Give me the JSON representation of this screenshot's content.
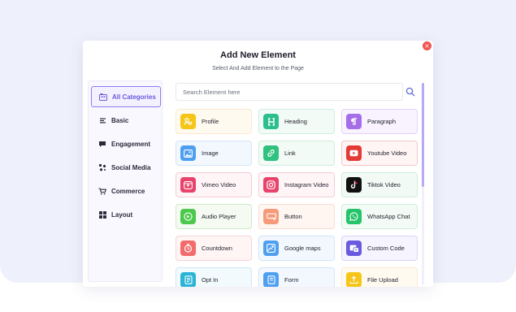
{
  "modal": {
    "title": "Add New Element",
    "subtitle": "Select And Add Element to the Page",
    "close_label": "×"
  },
  "sidebar": {
    "items": [
      {
        "label": "All Categories",
        "icon": "grid-folder-icon",
        "active": true
      },
      {
        "label": "Basic",
        "icon": "list-icon"
      },
      {
        "label": "Engagement",
        "icon": "chat-icon"
      },
      {
        "label": "Social Media",
        "icon": "share-nodes-icon"
      },
      {
        "label": "Commerce",
        "icon": "cart-icon"
      },
      {
        "label": "Layout",
        "icon": "layout-grid-icon"
      }
    ]
  },
  "search": {
    "placeholder": "Search Element here",
    "icon": "search-icon"
  },
  "elements": [
    {
      "label": "Profile",
      "icon": "profile-icon",
      "color": "#f5c518",
      "bg": "#fffaf0",
      "border": "#fbe8cf"
    },
    {
      "label": "Heading",
      "icon": "heading-icon",
      "color": "#2bbf8e",
      "bg": "#f3fbf7",
      "border": "#cdeee0"
    },
    {
      "label": "Paragraph",
      "icon": "paragraph-icon",
      "color": "#a56ee8",
      "bg": "#f8f3ff",
      "border": "#e3d3f7"
    },
    {
      "label": "Image",
      "icon": "image-icon",
      "color": "#4f9ff0",
      "bg": "#f3f8ff",
      "border": "#d2e4f7"
    },
    {
      "label": "Link",
      "icon": "link-icon",
      "color": "#2ec27e",
      "bg": "#f3fbf6",
      "border": "#cdeedc"
    },
    {
      "label": "Youtube Video",
      "icon": "youtube-icon",
      "color": "#e53935",
      "bg": "#fff5f5",
      "border": "#f3c7c7"
    },
    {
      "label": "Vimeo Video",
      "icon": "vimeo-icon",
      "color": "#e8436a",
      "bg": "#fff4f6",
      "border": "#f4cdd7"
    },
    {
      "label": "Instagram Video",
      "icon": "instagram-icon",
      "color": "#e8436a",
      "bg": "#fff4f6",
      "border": "#f4cdd7"
    },
    {
      "label": "Tiktok Video",
      "icon": "tiktok-icon",
      "color": "#111111",
      "bg": "#f2faf6",
      "border": "#cdeedc"
    },
    {
      "label": "Audio Player",
      "icon": "audio-icon",
      "color": "#4cc94c",
      "bg": "#f5fbf2",
      "border": "#cfe9c8"
    },
    {
      "label": "Button",
      "icon": "button-icon",
      "color": "#f59b7a",
      "bg": "#fff6f2",
      "border": "#f7dcd0"
    },
    {
      "label": "WhatsApp Chat",
      "icon": "whatsapp-icon",
      "color": "#25c36a",
      "bg": "#f2fbf5",
      "border": "#cdeed9"
    },
    {
      "label": "Countdown",
      "icon": "countdown-icon",
      "color": "#f36b6b",
      "bg": "#fff5f5",
      "border": "#f6d3d3"
    },
    {
      "label": "Google maps",
      "icon": "map-icon",
      "color": "#4f9ff0",
      "bg": "#f3f8ff",
      "border": "#d2e4f7"
    },
    {
      "label": "Custom Code",
      "icon": "code-icon",
      "color": "#6a5ae0",
      "bg": "#f6f4ff",
      "border": "#d9d3f7"
    },
    {
      "label": "Opt In",
      "icon": "optin-icon",
      "color": "#2bb4d6",
      "bg": "#f2fafd",
      "border": "#cce9f2"
    },
    {
      "label": "Form",
      "icon": "form-icon",
      "color": "#4f9ff0",
      "bg": "#f3f8ff",
      "border": "#d2e4f7"
    },
    {
      "label": "File Upload",
      "icon": "upload-icon",
      "color": "#f5c518",
      "bg": "#fffaf0",
      "border": "#fbe8cf"
    }
  ]
}
